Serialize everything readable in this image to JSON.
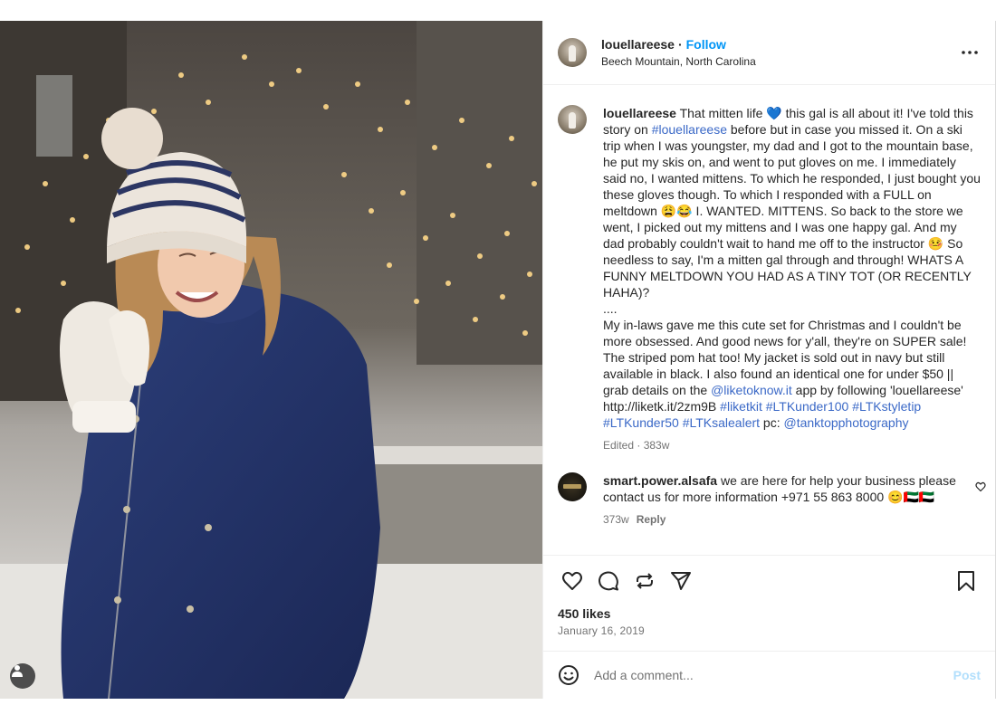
{
  "post": {
    "username": "louellareese",
    "follow_label": "Follow",
    "location": "Beech Mountain, North Carolina"
  },
  "caption": {
    "username": "louellareese",
    "text_1": " That mitten life 💙 this gal is all about it! I've told this story on ",
    "link_1": "#louellareese",
    "text_2": " before but in case you missed it. On a ski trip when I was youngster, my dad and I got to the mountain base, he put my skis on, and went to put gloves on me. I immediately said no, I wanted mittens. To which he responded, I just bought you these gloves though. To which I responded with a FULL on meltdown 😩😂 I. WANTED. MITTENS. So back to the store we went, I picked out my mittens and I was one happy gal. And my dad probably couldn't wait to hand me off to the instructor 🤒 So needless to say, I'm a mitten gal through and through! WHATS A FUNNY MELTDOWN YOU HAD AS A TINY TOT (OR RECENTLY HAHA)?\n....\nMy in-laws gave me this cute set for Christmas and I couldn't be more obsessed. And good news for y'all, they're on SUPER sale! The striped pom hat too! My jacket is sold out in navy but still available in black. I also found an identical one for under $50 || grab details on the ",
    "link_2": "@liketoknow.it",
    "text_3": " app by following 'louellareese' http://liketk.it/2zm9B ",
    "link_3": "#liketkit #LTKunder100 #LTKstyletip #LTKunder50 #LTKsalealert",
    "text_4": " pc: ",
    "link_4": "@tanktopphotography",
    "meta": "Edited · 383w"
  },
  "comment": {
    "username": "smart.power.alsafa",
    "text": " we are here for help your business please contact us for more information +971 55 863 8000 😊🇦🇪🇦🇪",
    "time": "373w",
    "reply_label": "Reply"
  },
  "likes": "450 likes",
  "date": "January 16, 2019",
  "add_comment": {
    "placeholder": "Add a comment...",
    "post_label": "Post"
  },
  "colors": {
    "link": "#3b69c7",
    "follow": "#0095f6",
    "post_button": "#b2dffc"
  }
}
